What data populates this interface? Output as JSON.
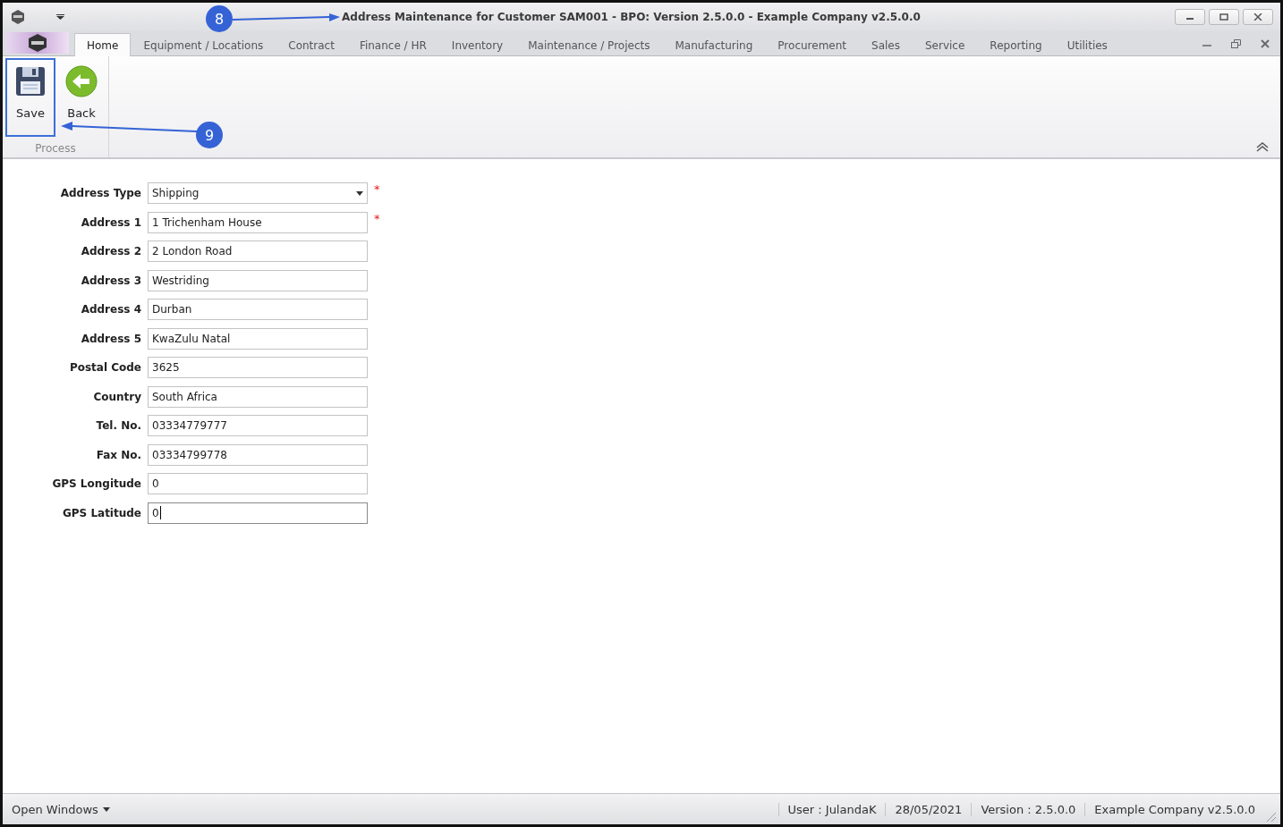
{
  "window": {
    "title": "Address Maintenance for Customer SAM001 - BPO: Version 2.5.0.0 - Example Company v2.5.0.0"
  },
  "tabs": [
    {
      "label": "Home",
      "selected": true
    },
    {
      "label": "Equipment / Locations",
      "selected": false
    },
    {
      "label": "Contract",
      "selected": false
    },
    {
      "label": "Finance / HR",
      "selected": false
    },
    {
      "label": "Inventory",
      "selected": false
    },
    {
      "label": "Maintenance / Projects",
      "selected": false
    },
    {
      "label": "Manufacturing",
      "selected": false
    },
    {
      "label": "Procurement",
      "selected": false
    },
    {
      "label": "Sales",
      "selected": false
    },
    {
      "label": "Service",
      "selected": false
    },
    {
      "label": "Reporting",
      "selected": false
    },
    {
      "label": "Utilities",
      "selected": false
    }
  ],
  "ribbon": {
    "group": "Process",
    "buttons": [
      {
        "kind": "save",
        "label": "Save",
        "highlighted": true
      },
      {
        "kind": "back",
        "label": "Back",
        "highlighted": false
      }
    ]
  },
  "form": [
    {
      "label": "Address Type",
      "value": "Shipping",
      "kind": "dropdown",
      "required_mark": "*",
      "focused": false
    },
    {
      "label": "Address 1",
      "value": "1 Trichenham House",
      "kind": "text",
      "required_mark": "*",
      "focused": false
    },
    {
      "label": "Address 2",
      "value": "2 London Road",
      "kind": "text",
      "focused": false
    },
    {
      "label": "Address 3",
      "value": "Westriding",
      "kind": "text",
      "focused": false
    },
    {
      "label": "Address 4",
      "value": "Durban",
      "kind": "text",
      "focused": false
    },
    {
      "label": "Address 5",
      "value": "KwaZulu Natal",
      "kind": "text",
      "focused": false
    },
    {
      "label": "Postal Code",
      "value": "3625",
      "kind": "text",
      "focused": false
    },
    {
      "label": "Country",
      "value": "South Africa",
      "kind": "text",
      "focused": false
    },
    {
      "label": "Tel. No.",
      "value": "03334779777",
      "kind": "text",
      "focused": false
    },
    {
      "label": "Fax No.",
      "value": "03334799778",
      "kind": "text",
      "focused": false
    },
    {
      "label": "GPS Longitude",
      "value": "0",
      "kind": "text",
      "focused": false
    },
    {
      "label": "GPS Latitude",
      "value": "0",
      "kind": "text",
      "focused": true
    }
  ],
  "callouts": [
    {
      "number": "8"
    },
    {
      "number": "9"
    }
  ],
  "status_bar": {
    "open_windows": "Open Windows",
    "items": [
      "User : JulandaK",
      "28/05/2021",
      "Version : 2.5.0.0",
      "Example Company v2.5.0.0"
    ]
  }
}
